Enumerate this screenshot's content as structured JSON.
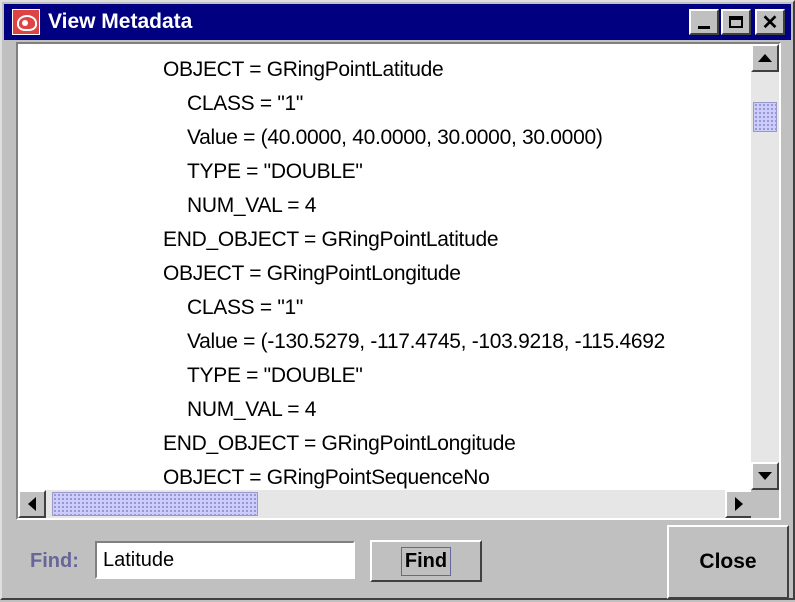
{
  "window": {
    "title": "View Metadata",
    "icons": [
      "app-icon",
      "minimize-icon",
      "maximize-icon",
      "close-icon"
    ]
  },
  "metadata_lines": [
    {
      "indent": 0,
      "text": "OBJECT = GRingPointLatitude"
    },
    {
      "indent": 1,
      "text": "CLASS = \"1\""
    },
    {
      "indent": 1,
      "text": "Value = (40.0000, 40.0000, 30.0000, 30.0000)"
    },
    {
      "indent": 1,
      "text": "TYPE = \"DOUBLE\""
    },
    {
      "indent": 1,
      "text": "NUM_VAL = 4"
    },
    {
      "indent": 0,
      "text": "END_OBJECT = GRingPointLatitude"
    },
    {
      "indent": 0,
      "text": "OBJECT = GRingPointLongitude"
    },
    {
      "indent": 1,
      "text": "CLASS = \"1\""
    },
    {
      "indent": 1,
      "text": "Value = (-130.5279, -117.4745, -103.9218, -115.4692"
    },
    {
      "indent": 1,
      "text": "TYPE = \"DOUBLE\""
    },
    {
      "indent": 1,
      "text": "NUM_VAL = 4"
    },
    {
      "indent": 0,
      "text": "END_OBJECT = GRingPointLongitude"
    },
    {
      "indent": 0,
      "text": "OBJECT = GRingPointSequenceNo"
    }
  ],
  "find": {
    "label": "Find:",
    "value": "Latitude",
    "button_label": "Find"
  },
  "close_label": "Close",
  "colors": {
    "titlebar": "#000080",
    "find_label": "#666699",
    "scroll_thumb": "#ccccff"
  }
}
